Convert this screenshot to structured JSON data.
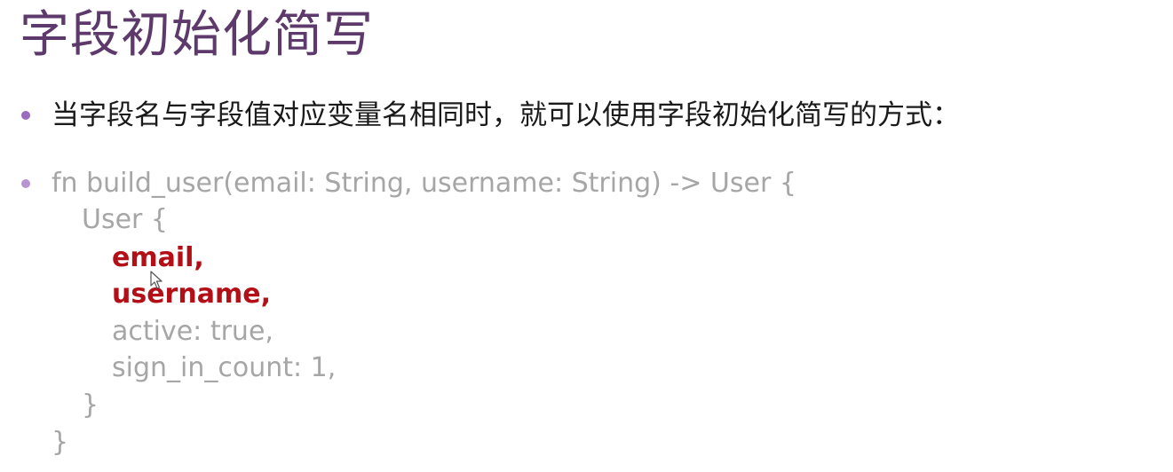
{
  "slide": {
    "title": "字段初始化简写",
    "bullets": [
      "当字段名与字段值对应变量名相同时，就可以使用字段初始化简写的方式："
    ],
    "code_lines": [
      "fn build_user(email: String, username: String) -> User {",
      "User {",
      "email,",
      "username,",
      "active: true,",
      "sign_in_count: 1,",
      "}",
      "}"
    ]
  },
  "colors": {
    "title": "#5d3a6b",
    "bullet": "#9b6bbf",
    "code": "#a6a6a6",
    "highlight": "#b30f16"
  }
}
